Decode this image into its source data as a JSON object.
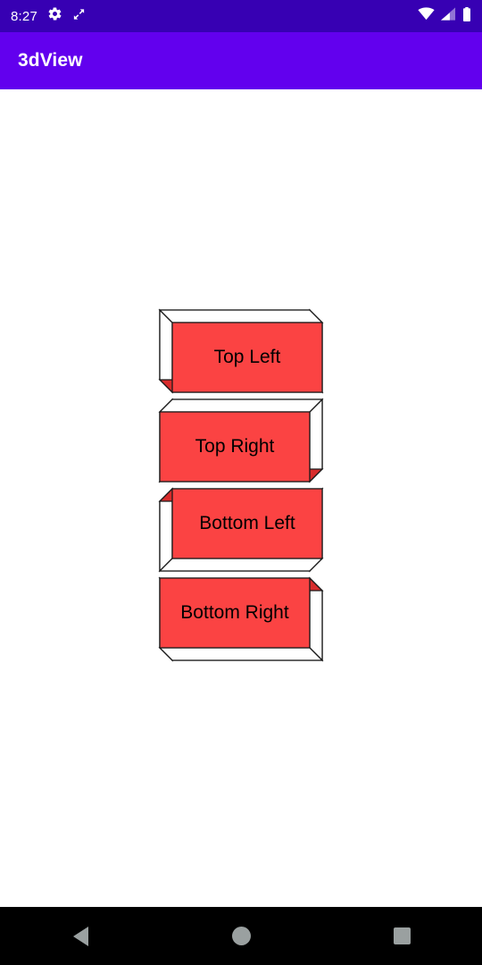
{
  "status_bar": {
    "time": "8:27",
    "icons": [
      "gear-icon",
      "expand-arrows-icon"
    ],
    "right_icons": [
      "wifi-icon",
      "cell-signal-icon",
      "battery-icon"
    ],
    "background_color": "#3700b3",
    "foreground_color": "#ffffff"
  },
  "app_bar": {
    "title": "3dView",
    "background_color": "#6200ee",
    "title_color": "#ffffff"
  },
  "content": {
    "background_color": "#ffffff",
    "colors": {
      "face": "#fb4343",
      "bevel_light": "#ffffff",
      "bevel_dark": "#d82c2c",
      "outline": "#1a1a1a",
      "text": "#000000"
    },
    "buttons": [
      {
        "label": "Top Left",
        "light_direction": "top-left",
        "depth": 14
      },
      {
        "label": "Top Right",
        "light_direction": "top-right",
        "depth": 14
      },
      {
        "label": "Bottom Left",
        "light_direction": "bottom-left",
        "depth": 14
      },
      {
        "label": "Bottom Right",
        "light_direction": "bottom-right",
        "depth": 14
      }
    ]
  },
  "nav_bar": {
    "background_color": "#000000",
    "icon_color": "#9aa0a0",
    "buttons": [
      "back-button",
      "home-button",
      "recents-button"
    ]
  }
}
